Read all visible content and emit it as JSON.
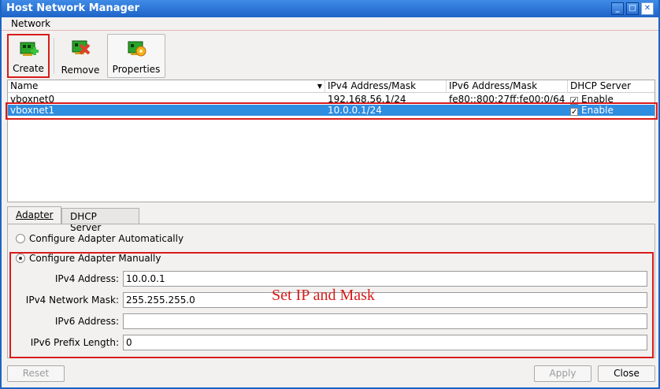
{
  "window": {
    "title": "Host Network Manager"
  },
  "menu": {
    "network": "Network"
  },
  "toolbar": {
    "create": "Create",
    "remove": "Remove",
    "properties": "Properties"
  },
  "table": {
    "headers": {
      "name": "Name",
      "ipv4": "IPv4 Address/Mask",
      "ipv6": "IPv6 Address/Mask",
      "dhcp": "DHCP Server"
    },
    "rows": [
      {
        "name": "vboxnet0",
        "ipv4": "192.168.56.1/24",
        "ipv6": "fe80::800:27ff:fe00:0/64",
        "dhcp": "Enable"
      },
      {
        "name": "vboxnet1",
        "ipv4": "10.0.0.1/24",
        "ipv6": "",
        "dhcp": "Enable"
      }
    ]
  },
  "tabs": {
    "adapter": "Adapter",
    "dhcp": "DHCP Server"
  },
  "adapter": {
    "auto_label": "Configure Adapter Automatically",
    "manual_label": "Configure Adapter Manually",
    "ipv4_address_label": "IPv4 Address:",
    "ipv4_address": "10.0.0.1",
    "ipv4_mask_label": "IPv4 Network Mask:",
    "ipv4_mask": "255.255.255.0",
    "ipv6_address_label": "IPv6 Address:",
    "ipv6_address": "",
    "ipv6_prefix_label": "IPv6 Prefix Length:",
    "ipv6_prefix": "0"
  },
  "annotation": "Set IP and Mask",
  "buttons": {
    "reset": "Reset",
    "apply": "Apply",
    "close": "Close"
  },
  "colors": {
    "accent": "#2f8de0",
    "highlight": "#d81b1b",
    "titlebar": "#1e63c8"
  }
}
